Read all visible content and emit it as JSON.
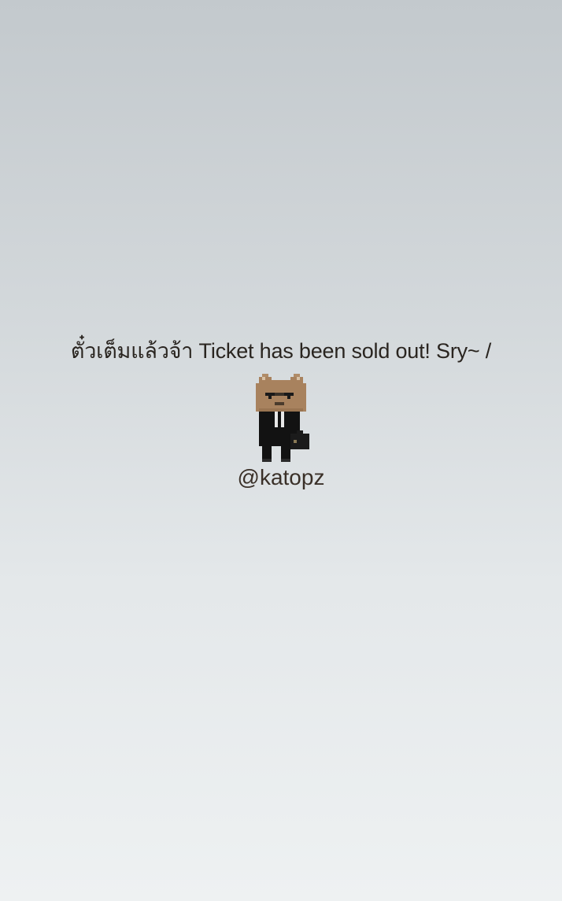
{
  "notice": {
    "message": "ตั๋วเต็มแล้วจ้า Ticket has been sold out! Sry~ /",
    "mascot_icon": "pixel-cat-businessman-icon",
    "handle": "@katopz"
  },
  "colors": {
    "background_top": "#c3c9cd",
    "background_bottom": "#eef1f2",
    "text": "#2a2520",
    "cat_fur": "#a8825e",
    "suit": "#121212"
  }
}
